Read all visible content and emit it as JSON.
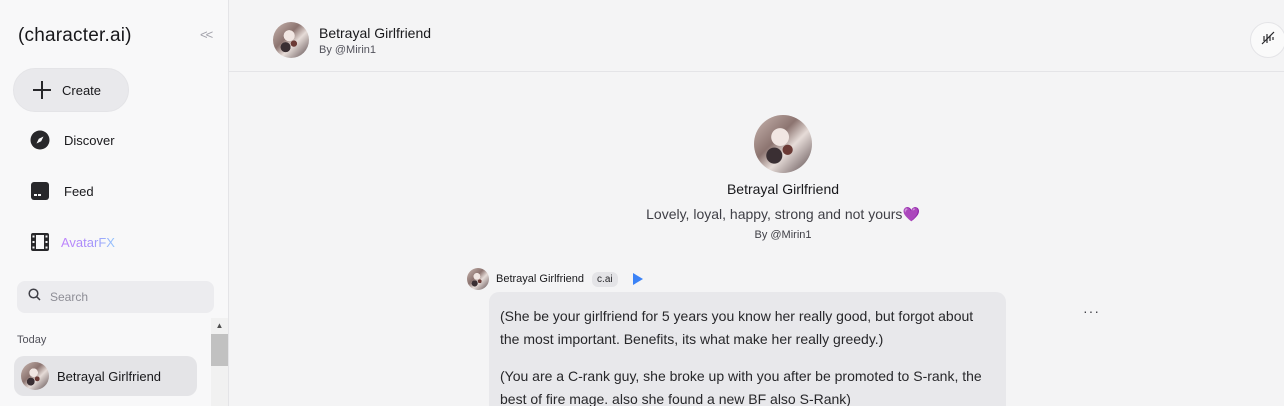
{
  "sidebar": {
    "logo": "(character.ai)",
    "collapse_icon": "double-chevron-left-icon",
    "create_label": "Create",
    "nav": {
      "discover": "Discover",
      "feed": "Feed",
      "avatarfx": "AvatarFX"
    },
    "search_placeholder": "Search",
    "section_today": "Today",
    "recent_chat": "Betrayal Girlfriend"
  },
  "header": {
    "character_name": "Betrayal Girlfriend",
    "creator": "By @Mirin1"
  },
  "profile": {
    "name": "Betrayal Girlfriend",
    "tagline": "Lovely, loyal, happy, strong and not yours",
    "tagline_emoji": "💜",
    "creator": "By @Mirin1"
  },
  "message": {
    "author": "Betrayal Girlfriend",
    "badge": "c.ai",
    "paragraphs": [
      "(She be your girlfriend for 5 years you know her really good, but forgot about the most important. Benefits, its what make her  really greedy.)",
      "(You are a C-rank guy, she broke up with you after be promoted to S-rank, the best of fire mage. also she found a new BF also S-Rank)"
    ],
    "more": "···"
  },
  "colors": {
    "background": "#f4f4f5",
    "sidebar": "#f8f8f9",
    "bubble": "#e8e8eb",
    "play_accent": "#3b82f6",
    "heart": "#a21caf"
  }
}
